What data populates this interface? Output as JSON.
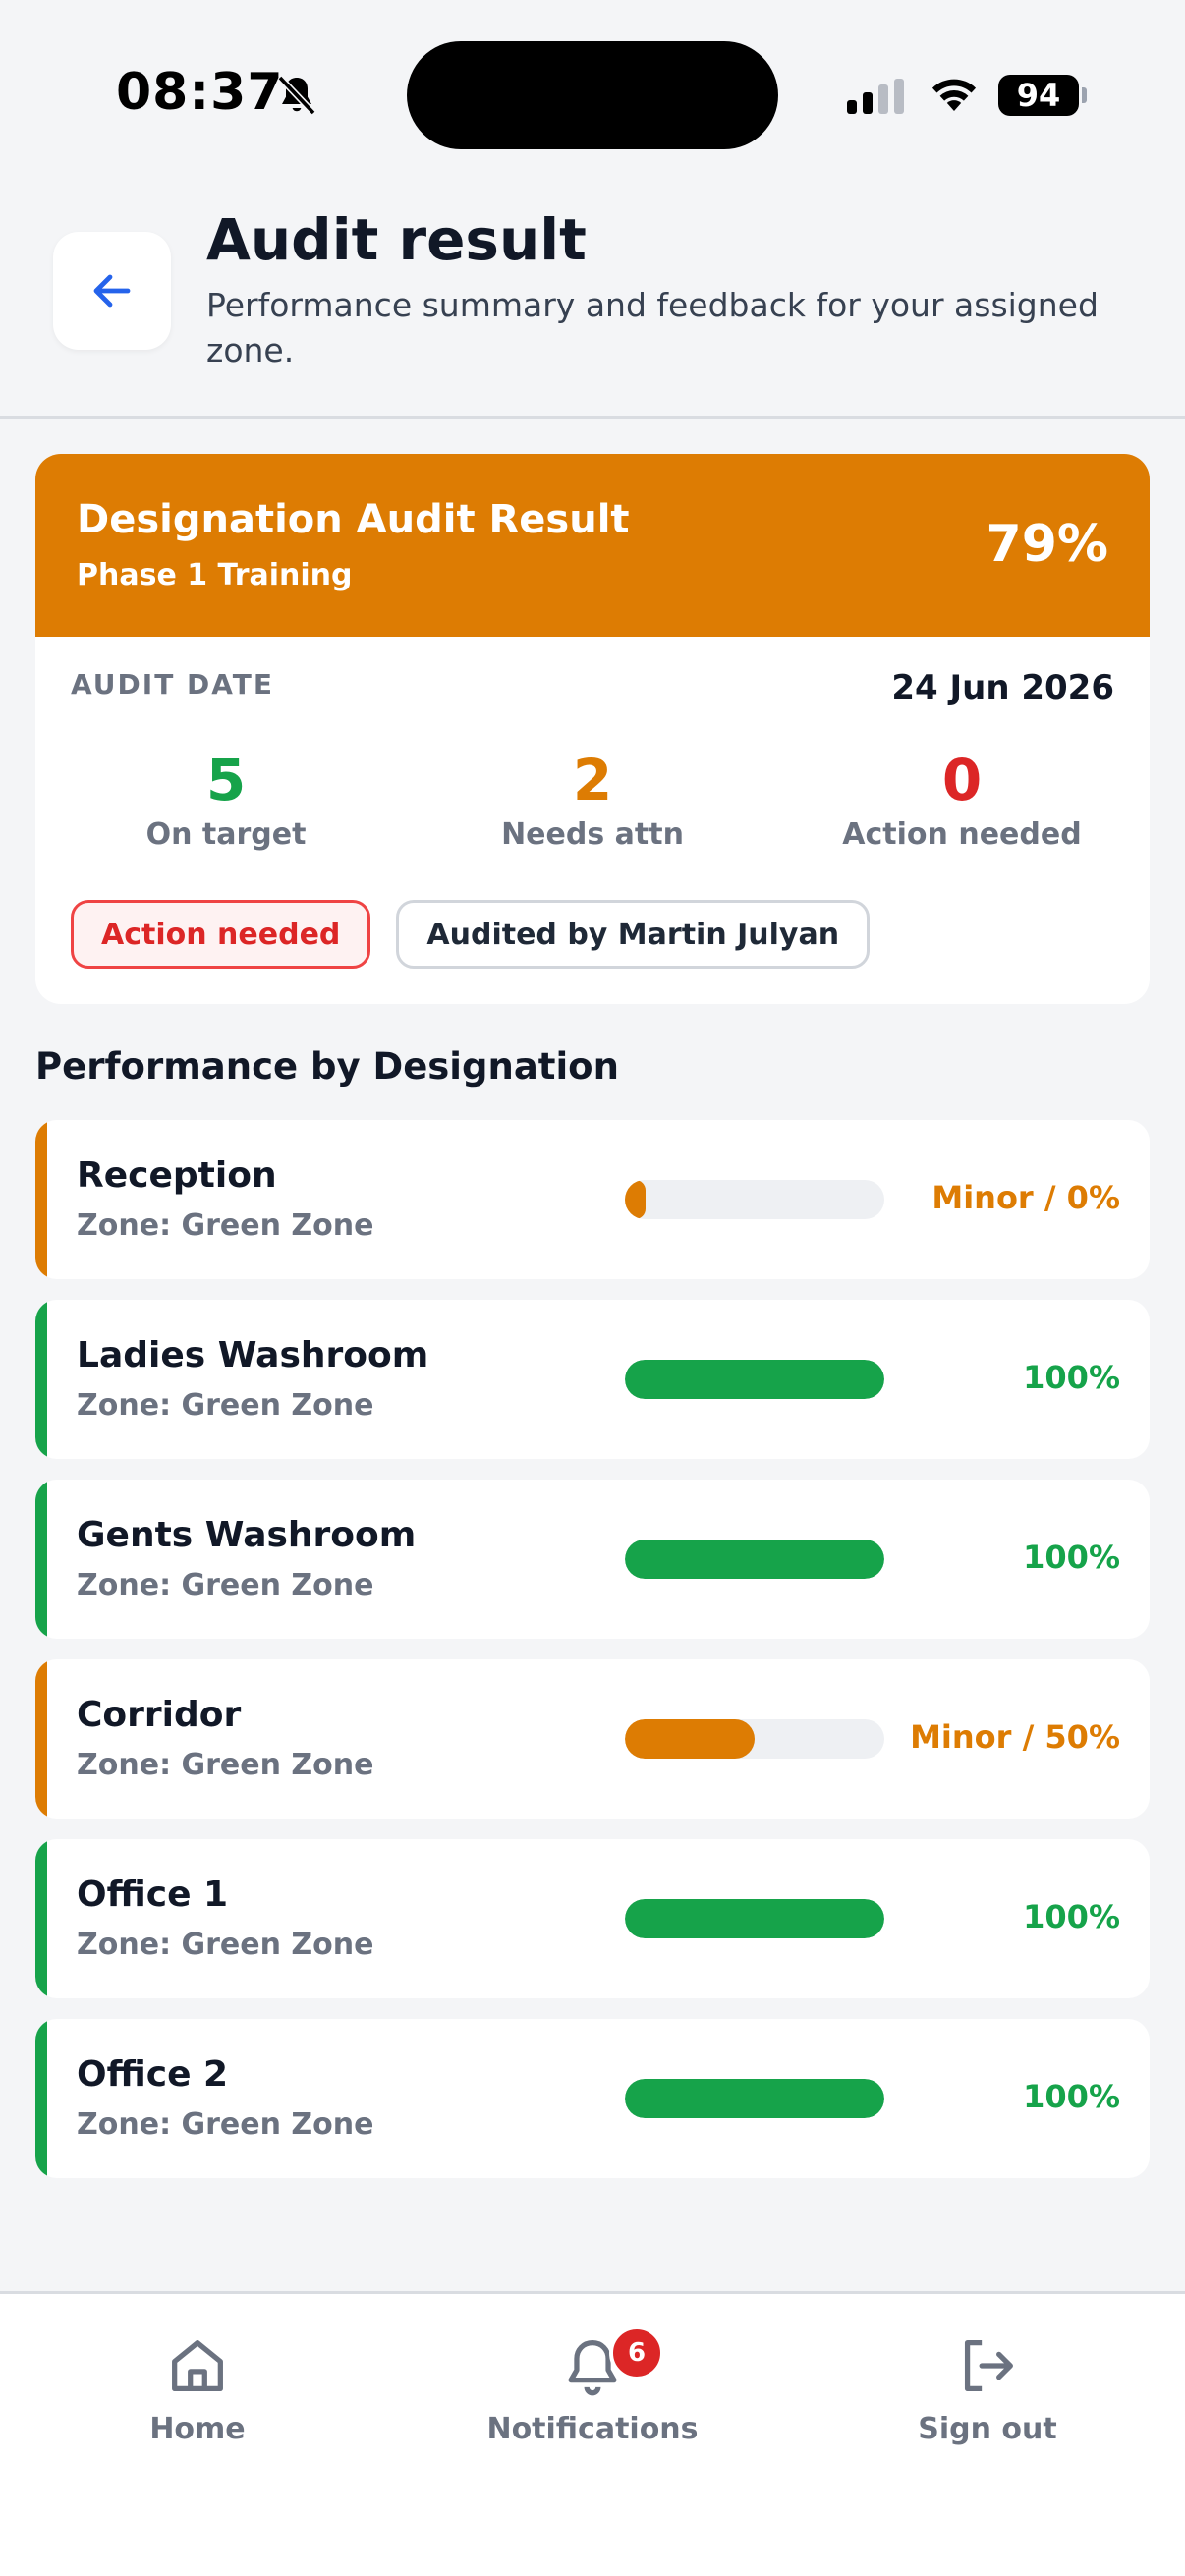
{
  "status_bar": {
    "time": "08:37",
    "battery": "94"
  },
  "header": {
    "title": "Audit result",
    "subtitle": "Performance summary and feedback for your assigned zone."
  },
  "audit": {
    "title": "Designation Audit Result",
    "phase": "Phase 1 Training",
    "score": "79%",
    "date_label": "AUDIT DATE",
    "date_value": "24 Jun 2026",
    "stats": [
      {
        "value": "5",
        "label": "On target",
        "color": "#16a34a"
      },
      {
        "value": "2",
        "label": "Needs attn",
        "color": "#dd7c03"
      },
      {
        "value": "0",
        "label": "Action needed",
        "color": "#dc2626"
      }
    ],
    "status_chip": "Action needed",
    "auditor_chip": "Audited by Martin Julyan",
    "banner_color": "#dd7c03"
  },
  "performance": {
    "title": "Performance by Designation",
    "items": [
      {
        "name": "Reception",
        "zone": "Zone: Green Zone",
        "status": "Minor / 0%",
        "progress": 0.08,
        "color": "#dd7c03"
      },
      {
        "name": "Ladies Washroom",
        "zone": "Zone: Green Zone",
        "status": "100%",
        "progress": 1.0,
        "color": "#16a34a"
      },
      {
        "name": "Gents Washroom",
        "zone": "Zone: Green Zone",
        "status": "100%",
        "progress": 1.0,
        "color": "#16a34a"
      },
      {
        "name": "Corridor",
        "zone": "Zone: Green Zone",
        "status": "Minor / 50%",
        "progress": 0.5,
        "color": "#dd7c03"
      },
      {
        "name": "Office 1",
        "zone": "Zone: Green Zone",
        "status": "100%",
        "progress": 1.0,
        "color": "#16a34a"
      },
      {
        "name": "Office 2",
        "zone": "Zone: Green Zone",
        "status": "100%",
        "progress": 1.0,
        "color": "#16a34a"
      }
    ]
  },
  "nav": {
    "home": "Home",
    "notifications": "Notifications",
    "notifications_badge": "6",
    "signout": "Sign out"
  }
}
